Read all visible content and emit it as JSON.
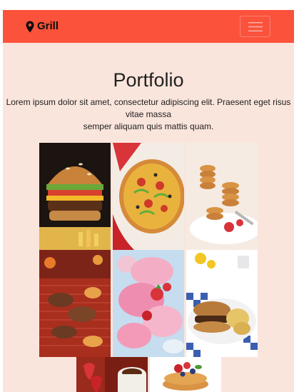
{
  "navbar": {
    "brand_label": "Grill",
    "brand_icon": "map-marker-icon",
    "menu_icon": "hamburger-menu-icon",
    "background_color": "#fb523b"
  },
  "portfolio": {
    "title": "Portfolio",
    "description_line1": "Lorem ipsum dolor sit amet, consectetur adipiscing elit. Praesent eget risus vitae massa",
    "description_line2": "semper aliquam quis mattis quam.",
    "background_color": "#fae5dc",
    "images": [
      {
        "subject": "burger"
      },
      {
        "subject": "pizza"
      },
      {
        "subject": "pancakes"
      },
      {
        "subject": "grilled-meat"
      },
      {
        "subject": "ice-cream"
      },
      {
        "subject": "burger-and-chips"
      },
      {
        "subject": "strawberries-and-coffee"
      },
      {
        "subject": "pancakes-with-berries"
      }
    ]
  }
}
